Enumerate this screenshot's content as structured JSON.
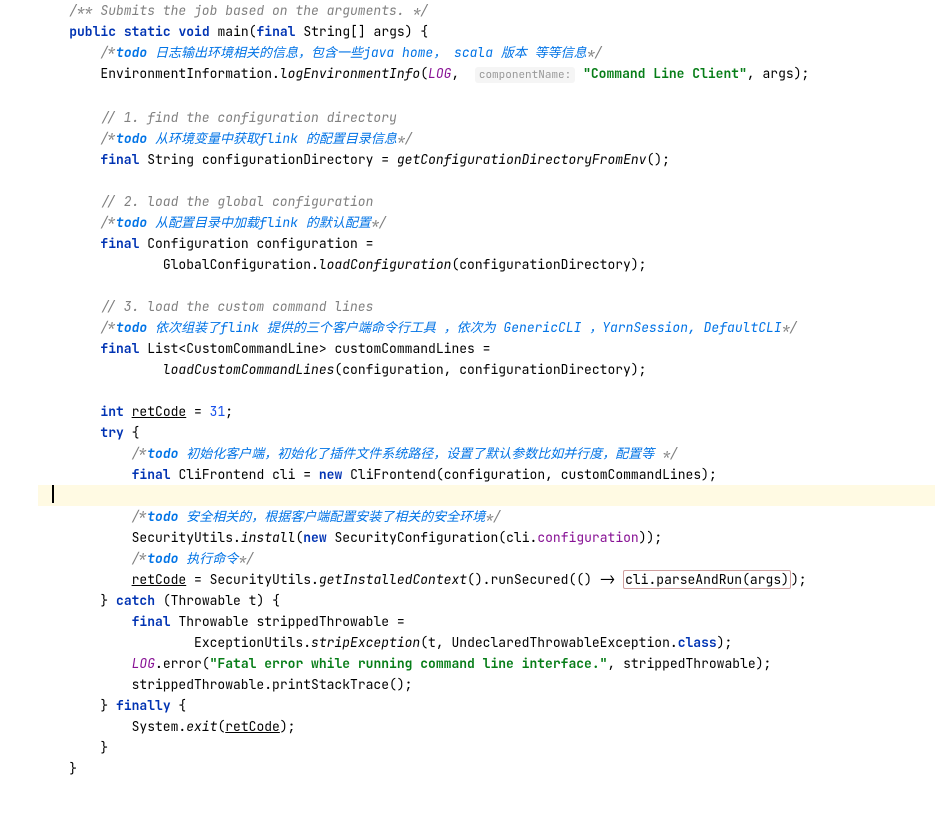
{
  "lines": {
    "l1": "/** Submits the job based on the arguments. */",
    "l2_public": "public",
    "l2_static": "static",
    "l2_void": "void",
    "l2_main": "main",
    "l2_final": "final",
    "l2_type": "String[]",
    "l2_param": "args",
    "l3_todo": "todo",
    "l3_text": " 日志输出环境相关的信息，包含一些java home， scala 版本 等等信息",
    "l4_class": "EnvironmentInformation",
    "l4_method": "logEnvironmentInfo",
    "l4_log": "LOG",
    "l4_hint": "componentName:",
    "l4_str": "\"Command Line Client\"",
    "l4_args": "args",
    "l5": "// 1. find the configuration directory",
    "l6_todo": "todo",
    "l6_text": " 从环境变量中获取flink 的配置目录信息",
    "l7_final": "final",
    "l7_type": "String",
    "l7_var": "configurationDirectory",
    "l7_method": "getConfigurationDirectoryFromEnv",
    "l8": "// 2. load the global configuration",
    "l9_todo": "todo",
    "l9_text": " 从配置目录中加载flink 的默认配置",
    "l10_final": "final",
    "l10_type": "Configuration",
    "l10_var": "configuration",
    "l11_class": "GlobalConfiguration",
    "l11_method": "loadConfiguration",
    "l11_arg": "configurationDirectory",
    "l12": "// 3. load the custom command lines",
    "l13_todo": "todo",
    "l13_text": " 依次组装了flink 提供的三个客户端命令行工具 ，依次为 GenericCLI ，YarnSession, DefaultCLI",
    "l14_final": "final",
    "l14_type": "List<CustomCommandLine>",
    "l14_var": "customCommandLines",
    "l15_method": "loadCustomCommandLines",
    "l15_arg1": "configuration",
    "l15_arg2": "configurationDirectory",
    "l16_int": "int",
    "l16_var": "retCode",
    "l16_val": "31",
    "l17_try": "try",
    "l18_todo": "todo",
    "l18_text": " 初始化客户端，初始化了插件文件系统路径，设置了默认参数比如并行度，配置等 ",
    "l19_final": "final",
    "l19_type": "CliFrontend",
    "l19_var": "cli",
    "l19_new": "new",
    "l19_ctor": "CliFrontend",
    "l19_arg1": "configuration",
    "l19_arg2": "customCommandLines",
    "l20_todo": "todo",
    "l20_text": " 安全相关的，根据客户端配置安装了相关的安全环境",
    "l21_class": "SecurityUtils",
    "l21_method": "install",
    "l21_new": "new",
    "l21_ctor": "SecurityConfiguration",
    "l21_obj": "cli",
    "l21_field": "configuration",
    "l22_todo": "todo",
    "l22_text": " 执行命令",
    "l23_var": "retCode",
    "l23_class": "SecurityUtils",
    "l23_m1": "getInstalledContext",
    "l23_m2": "runSecured",
    "l23_cli": "cli",
    "l23_m3": "parseAndRun",
    "l23_args": "args",
    "l24_catch": "catch",
    "l24_type": "Throwable",
    "l24_var": "t",
    "l25_final": "final",
    "l25_type": "Throwable",
    "l25_var": "strippedThrowable",
    "l26_class": "ExceptionUtils",
    "l26_method": "stripException",
    "l26_arg1": "t",
    "l26_arg2": "UndeclaredThrowableException",
    "l26_class2": "class",
    "l27_log": "LOG",
    "l27_method": "error",
    "l27_str": "\"Fatal error while running command line interface.\"",
    "l27_arg2": "strippedThrowable",
    "l28_var": "strippedThrowable",
    "l28_method": "printStackTrace",
    "l29_finally": "finally",
    "l30_class": "System",
    "l30_method": "exit",
    "l30_arg": "retCode"
  }
}
